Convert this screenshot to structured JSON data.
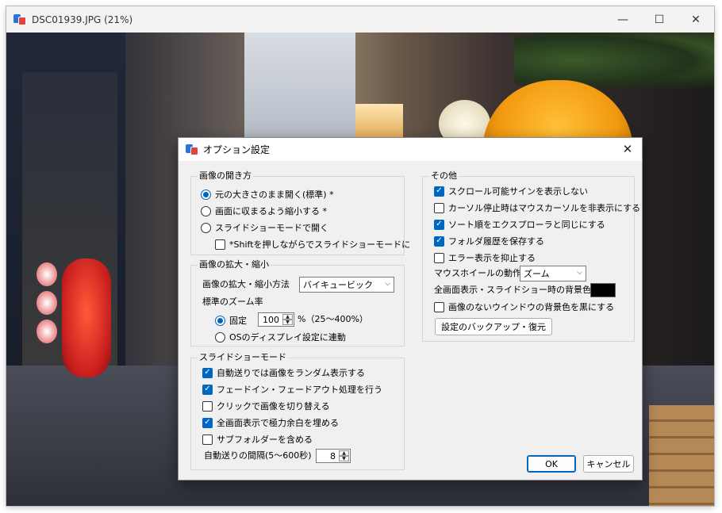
{
  "viewer": {
    "title": "DSC01939.JPG (21%)",
    "minimize_glyph": "—",
    "maximize_glyph": "☐",
    "close_glyph": "✕"
  },
  "dialog": {
    "title": "オプション設定",
    "close_glyph": "✕",
    "open_method": {
      "label": "画像の開き方",
      "options": [
        {
          "label": "元の大きさのまま開く(標準) *",
          "selected": true
        },
        {
          "label": "画面に収まるよう縮小する *",
          "selected": false
        },
        {
          "label": "スライドショーモードで開く",
          "selected": false
        }
      ],
      "shift_option": {
        "label": "*Shiftを押しながらでスライドショーモードに",
        "checked": false
      }
    },
    "zoom": {
      "label": "画像の拡大・縮小",
      "method_label": "画像の拡大・縮小方法",
      "method_value": "バイキュービック",
      "standard_label": "標準のズーム率",
      "fixed_label": "固定",
      "fixed_selected": true,
      "fixed_value": "100",
      "fixed_suffix": "%（25～400%）",
      "os_label": "OSのディスプレイ設定に連動",
      "os_selected": false
    },
    "slideshow": {
      "label": "スライドショーモード",
      "options": [
        {
          "label": "自動送りでは画像をランダム表示する",
          "checked": true
        },
        {
          "label": "フェードイン・フェードアウト処理を行う",
          "checked": true
        },
        {
          "label": "クリックで画像を切り替える",
          "checked": false
        },
        {
          "label": "全画面表示で極力余白を埋める",
          "checked": true
        },
        {
          "label": "サブフォルダーを含める",
          "checked": false
        }
      ],
      "interval_label": "自動送りの間隔(5～600秒)",
      "interval_value": "8"
    },
    "other": {
      "label": "その他",
      "options": [
        {
          "label": "スクロール可能サインを表示しない",
          "checked": true
        },
        {
          "label": "カーソル停止時はマウスカーソルを非表示にする",
          "checked": false
        },
        {
          "label": "ソート順をエクスプローラと同じにする",
          "checked": true
        },
        {
          "label": "フォルダ履歴を保存する",
          "checked": true
        },
        {
          "label": "エラー表示を抑止する",
          "checked": false
        }
      ],
      "wheel_label": "マウスホイールの動作",
      "wheel_value": "ズーム",
      "bg_label": "全画面表示・スライドショー時の背景色",
      "bg_color": "#000000",
      "black_bg_option": {
        "label": "画像のないウインドウの背景色を黒にする",
        "checked": false
      },
      "backup_button": "設定のバックアップ・復元"
    },
    "ok_button": "OK",
    "cancel_button": "キャンセル"
  },
  "colors": {
    "accent": "#0067c0",
    "dialog_bg": "#f0f0f0"
  }
}
